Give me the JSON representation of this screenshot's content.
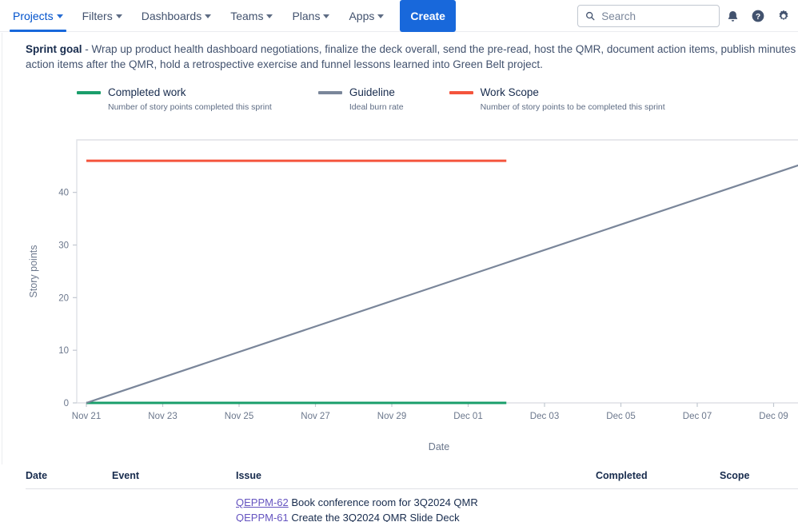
{
  "nav": {
    "items": [
      {
        "label": "Projects",
        "has_chevron": true,
        "active": true
      },
      {
        "label": "Filters",
        "has_chevron": true,
        "active": false
      },
      {
        "label": "Dashboards",
        "has_chevron": true,
        "active": false
      },
      {
        "label": "Teams",
        "has_chevron": true,
        "active": false
      },
      {
        "label": "Plans",
        "has_chevron": true,
        "active": false
      },
      {
        "label": "Apps",
        "has_chevron": true,
        "active": false
      }
    ],
    "create_label": "Create",
    "search": {
      "placeholder": "Search",
      "value": "",
      "icon": "search-icon"
    },
    "right_icons": [
      {
        "name": "notifications-icon"
      },
      {
        "name": "help-icon"
      },
      {
        "name": "settings-gear-icon"
      }
    ]
  },
  "sprint_goal": {
    "label": "Sprint goal",
    "separator": " - ",
    "text": "Wrap up product health dashboard negotiations, finalize the deck overall, send the pre-read, host the QMR, document action items, publish minutes and action items after the QMR, hold a retrospective exercise and funnel lessons learned into Green Belt project."
  },
  "legend": [
    {
      "title": "Completed work",
      "subtitle": "Number of story points completed this sprint",
      "color": "#1a9e6b"
    },
    {
      "title": "Guideline",
      "subtitle": "Ideal burn rate",
      "color": "#7A869A"
    },
    {
      "title": "Work Scope",
      "subtitle": "Number of story points to be completed this sprint",
      "color": "#F4543C"
    }
  ],
  "chart_data": {
    "type": "line",
    "title": "",
    "xlabel": "Date",
    "ylabel": "Story points",
    "grid": false,
    "legend_position": "above",
    "x_tick_labels": [
      "Nov 21",
      "Nov 23",
      "Nov 25",
      "Nov 27",
      "Nov 29",
      "Dec 01",
      "Dec 03",
      "Dec 05",
      "Dec 07",
      "Dec 09"
    ],
    "y_tick_labels": [
      "0",
      "10",
      "20",
      "30",
      "40"
    ],
    "y_ticks": [
      0,
      10,
      20,
      30,
      40
    ],
    "ylim": [
      0,
      48
    ],
    "xlim": [
      "Nov 21",
      "Dec 10"
    ],
    "series": [
      {
        "name": "Work Scope",
        "color": "#F4543C",
        "x": [
          "Nov 21",
          "Dec 02"
        ],
        "values": [
          46,
          46
        ]
      },
      {
        "name": "Completed work",
        "color": "#1a9e6b",
        "x": [
          "Nov 21",
          "Dec 02"
        ],
        "values": [
          0,
          0
        ]
      },
      {
        "name": "Guideline",
        "color": "#7A869A",
        "x": [
          "Nov 21",
          "Dec 10"
        ],
        "values": [
          0,
          46
        ]
      }
    ]
  },
  "table": {
    "columns": [
      "Date",
      "Event",
      "Issue",
      "Completed",
      "Scope"
    ],
    "rows": [
      {
        "date": "",
        "event": "",
        "issue_key": "QEPPM-62",
        "issue_summary": "Book conference room for 3Q2024 QMR",
        "completed": "",
        "scope": ""
      },
      {
        "date": "",
        "event": "",
        "issue_key": "QEPPM-61",
        "issue_summary": "Create the 3Q2024 QMR Slide Deck",
        "completed": "",
        "scope": ""
      }
    ]
  }
}
